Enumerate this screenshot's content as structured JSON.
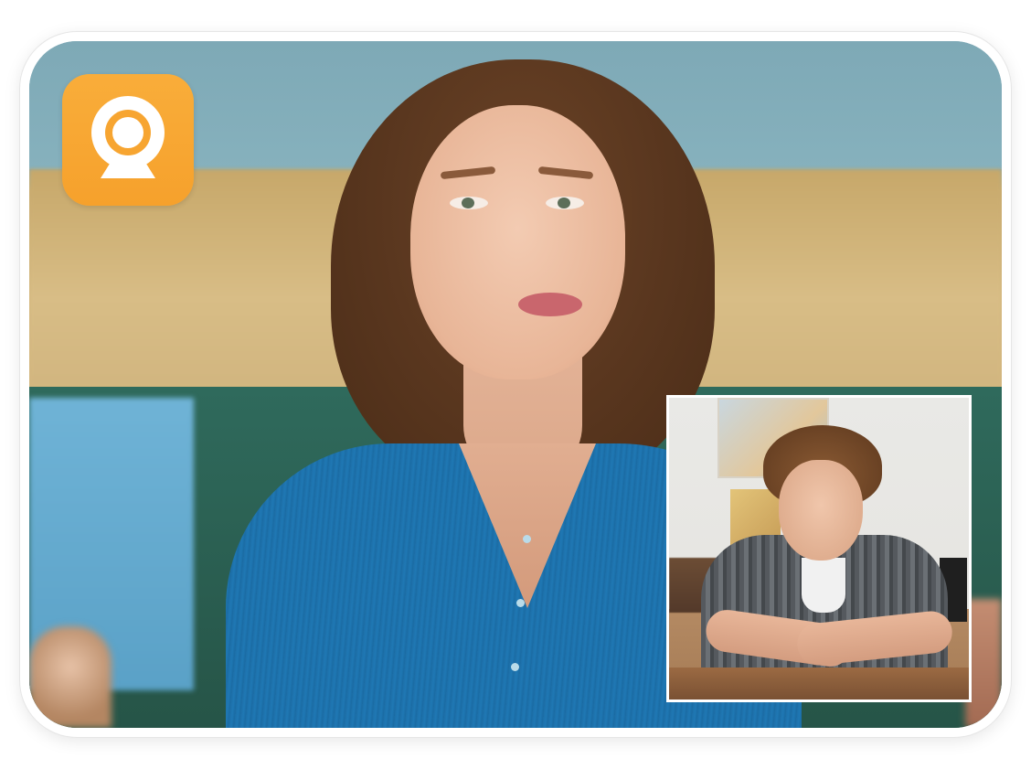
{
  "app": {
    "icon": "webcam-icon",
    "accent_color": "#F7A531"
  },
  "main_video": {
    "role": "main-video-feed"
  },
  "pip_video": {
    "role": "picture-in-picture-feed"
  }
}
